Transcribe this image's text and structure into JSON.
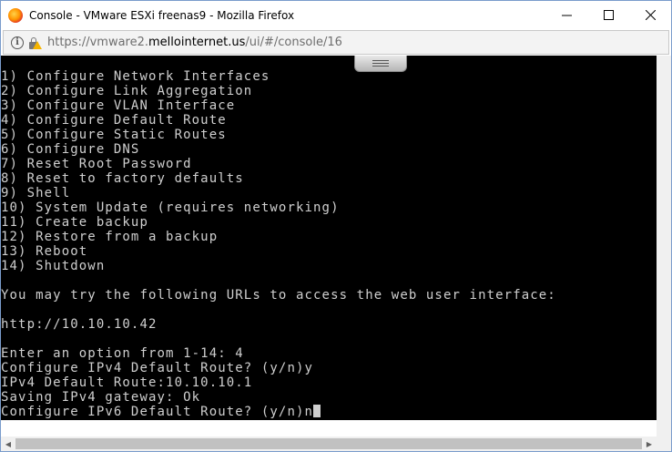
{
  "window": {
    "title": "Console - VMware ESXi freenas9 - Mozilla Firefox",
    "minimize_glyph": "—",
    "maximize_glyph": "☐",
    "close_glyph": "✕"
  },
  "addressbar": {
    "url_prefix": "https://vmware2.",
    "url_domain": "mellointernet.us",
    "url_suffix": "/ui/#/console/16",
    "info_glyph": "i"
  },
  "console": {
    "lines": [
      "1) Configure Network Interfaces",
      "2) Configure Link Aggregation",
      "3) Configure VLAN Interface",
      "4) Configure Default Route",
      "5) Configure Static Routes",
      "6) Configure DNS",
      "7) Reset Root Password",
      "8) Reset to factory defaults",
      "9) Shell",
      "10) System Update (requires networking)",
      "11) Create backup",
      "12) Restore from a backup",
      "13) Reboot",
      "14) Shutdown",
      "",
      "You may try the following URLs to access the web user interface:",
      "",
      "http://10.10.10.42",
      "",
      "Enter an option from 1-14: 4",
      "Configure IPv4 Default Route? (y/n)y",
      "IPv4 Default Route:10.10.10.1",
      "Saving IPv4 gateway: Ok",
      "Configure IPv6 Default Route? (y/n)n"
    ]
  },
  "icons": {
    "browser": "firefox-icon",
    "info": "info-icon",
    "security": "insecure-lock-icon",
    "handle": "console-handle-icon"
  },
  "colors": {
    "console_bg": "#000000",
    "console_text": "#cfcfcf",
    "window_border": "#7a9ccc"
  }
}
